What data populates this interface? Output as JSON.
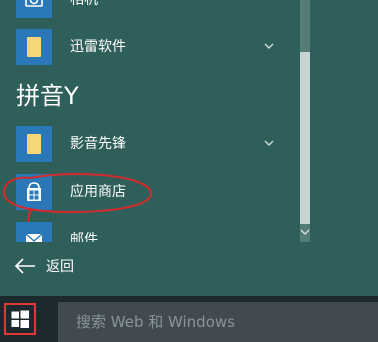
{
  "start_menu": {
    "app_list": {
      "items": [
        {
          "label": "相机",
          "has_chevron": false,
          "icon": "camera-icon"
        },
        {
          "label": "迅雷软件",
          "has_chevron": true,
          "icon": "folder-icon"
        },
        {
          "label": "影音先锋",
          "has_chevron": true,
          "icon": "folder-icon"
        },
        {
          "label": "应用商店",
          "has_chevron": false,
          "icon": "store-icon"
        },
        {
          "label": "邮件",
          "has_chevron": false,
          "icon": "mail-icon"
        }
      ],
      "section_header": "拼音Y"
    },
    "back_label": "返回"
  },
  "taskbar": {
    "start_icon": "windows-logo-icon",
    "search": {
      "placeholder": "搜索 Web 和 Windows"
    }
  },
  "colors": {
    "menu_background": "#2f5f5a",
    "tile_blue": "#2b78b8",
    "folder_yellow": "#f6d676",
    "taskbar": "#1c2a2f",
    "search_box": "#404a4f",
    "annotation_red": "#d42a2a",
    "start_highlight": "#e53535"
  }
}
